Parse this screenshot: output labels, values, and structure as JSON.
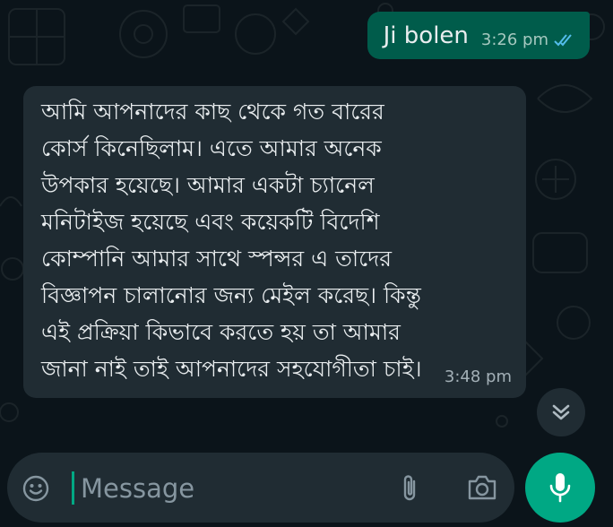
{
  "conversation": {
    "outgoing": {
      "text": "Ji bolen",
      "time": "3:26 pm",
      "status_icon": "double-check-icon"
    },
    "incoming": {
      "text": "আমি আপনাদের কাছ থেকে গত বারের কোর্স কিনেছিলাম। এতে আমার অনেক উপকার হয়েছে। আমার একটা চ্যানেল মনিটাইজ হয়েছে এবং কয়েকটি বিদেশি কোম্পানি আমার সাথে স্পন্সর এ তাদের বিজ্ঞাপন চালানোর জন্য মেইল করেছ। কিন্তু এই প্রক্রিয়া কিভাবে করতে হয় তা আমার জানা নাই তাই আপনাদের সহযোগীতা চাই।",
      "time": "3:48 pm"
    }
  },
  "composer": {
    "placeholder": "Message",
    "value": "",
    "icons": [
      "emoji-icon",
      "paperclip-icon",
      "camera-icon",
      "microphone-icon"
    ]
  },
  "scroll_button_icon": "double-chevron-down-icon",
  "colors": {
    "background": "#0b141a",
    "outgoing_bubble": "#005c4b",
    "incoming_bubble": "#202c33",
    "accent": "#00a884",
    "read_ticks": "#53bdeb"
  }
}
